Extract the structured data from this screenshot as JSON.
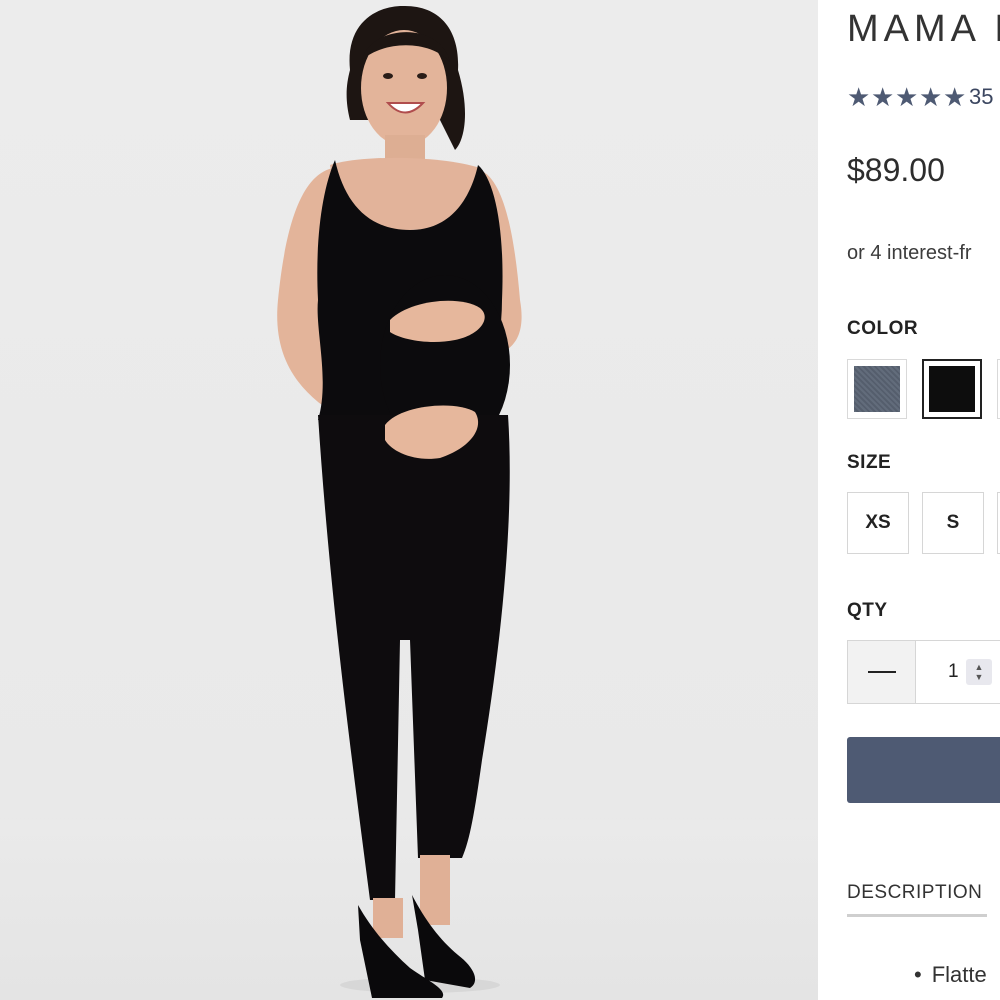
{
  "product": {
    "title": "MAMA M",
    "rating": {
      "stars": 5,
      "star_glyph": "★",
      "count_text": "35"
    },
    "price": "$89.00",
    "installment_text": "or 4 interest-fr"
  },
  "options": {
    "color": {
      "label": "COLOR",
      "swatches": [
        {
          "name": "heather-grey",
          "hex": "#5a6474",
          "selected": false
        },
        {
          "name": "black",
          "hex": "#0d0d0d",
          "selected": true
        }
      ]
    },
    "size": {
      "label": "SIZE",
      "values": [
        "XS",
        "S"
      ]
    },
    "qty": {
      "label": "QTY",
      "value": "1",
      "up_glyph": "▲",
      "down_glyph": "▼"
    }
  },
  "add_button": {
    "color": "#4e5a73"
  },
  "tabs": {
    "description_label": "DESCRIPTION"
  },
  "description": {
    "first_bullet": "Flatte"
  },
  "colors": {
    "accent": "#4e5a73",
    "star": "#4e5a73"
  }
}
